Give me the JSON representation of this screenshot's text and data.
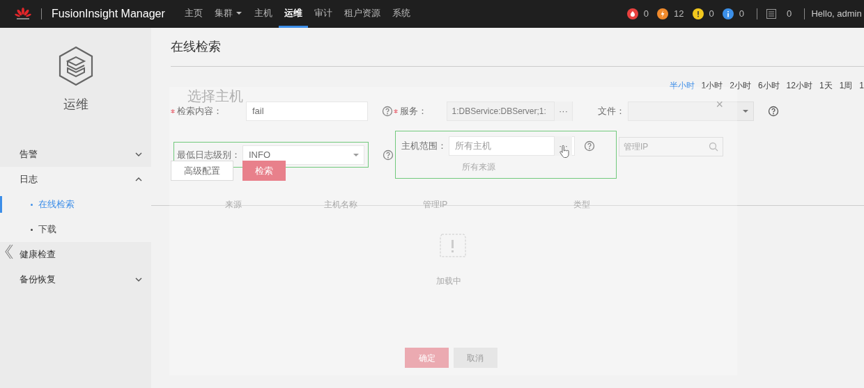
{
  "navbar": {
    "brand": "FusionInsight Manager",
    "items": [
      {
        "label": "主页",
        "selected": false,
        "dropdown": false
      },
      {
        "label": "集群",
        "selected": false,
        "dropdown": true
      },
      {
        "label": "主机",
        "selected": false,
        "dropdown": false
      },
      {
        "label": "运维",
        "selected": true,
        "dropdown": false
      },
      {
        "label": "审计",
        "selected": false,
        "dropdown": false
      },
      {
        "label": "租户资源",
        "selected": false,
        "dropdown": false
      },
      {
        "label": "系统",
        "selected": false,
        "dropdown": false
      }
    ],
    "alarms": [
      {
        "kind": "critical",
        "count": "0",
        "color": "#e8413f"
      },
      {
        "kind": "major",
        "count": "12",
        "color": "#f08a2c"
      },
      {
        "kind": "minor",
        "count": "0",
        "color": "#f2c81d"
      },
      {
        "kind": "info",
        "count": "0",
        "color": "#3b8fe8"
      }
    ],
    "tasks": "0",
    "greeting": "Hello, admin"
  },
  "sidebar": {
    "title": "运维",
    "items": [
      {
        "label": "告警",
        "kind": "group",
        "expanded": false
      },
      {
        "label": "日志",
        "kind": "group",
        "expanded": true,
        "children": [
          {
            "label": "在线检索",
            "selected": true
          },
          {
            "label": "下载",
            "selected": false
          }
        ]
      },
      {
        "label": "健康检查",
        "kind": "link"
      },
      {
        "label": "备份恢复",
        "kind": "group",
        "expanded": false
      }
    ]
  },
  "page": {
    "title": "在线检索",
    "time_ranges": [
      {
        "label": "半小时",
        "selected": true
      },
      {
        "label": "1小时",
        "selected": false
      },
      {
        "label": "2小时",
        "selected": false
      },
      {
        "label": "6小时",
        "selected": false
      },
      {
        "label": "12小时",
        "selected": false
      },
      {
        "label": "1天",
        "selected": false
      },
      {
        "label": "1周",
        "selected": false
      },
      {
        "label": "1",
        "selected": false
      }
    ],
    "form": {
      "keyword": {
        "label": "检索内容：",
        "required": true,
        "value": "fail"
      },
      "service": {
        "label": "服务：",
        "required": true,
        "value": "1:DBService:DBServer;1:",
        "button": "···"
      },
      "file": {
        "label": "文件："
      },
      "level": {
        "label": "最低日志级别：",
        "value": "INFO",
        "highlighted": true
      },
      "hosts": {
        "label": "主机范围：",
        "placeholder": "所有主机",
        "button": "···",
        "highlighted": true
      },
      "buttons": [
        {
          "label": "高级配置",
          "kind": "secondary"
        },
        {
          "label": "检索",
          "kind": "primary"
        }
      ]
    }
  },
  "modal": {
    "title": "选择主机",
    "close": "×",
    "source": "所有来源",
    "search_placeholder": "管理IP",
    "columns": [
      "来源",
      "主机名称",
      "管理IP",
      "类型"
    ],
    "empty_text": "加载中",
    "buttons": [
      {
        "label": "确定",
        "kind": "primary"
      },
      {
        "label": "取消",
        "kind": "secondary"
      }
    ]
  }
}
